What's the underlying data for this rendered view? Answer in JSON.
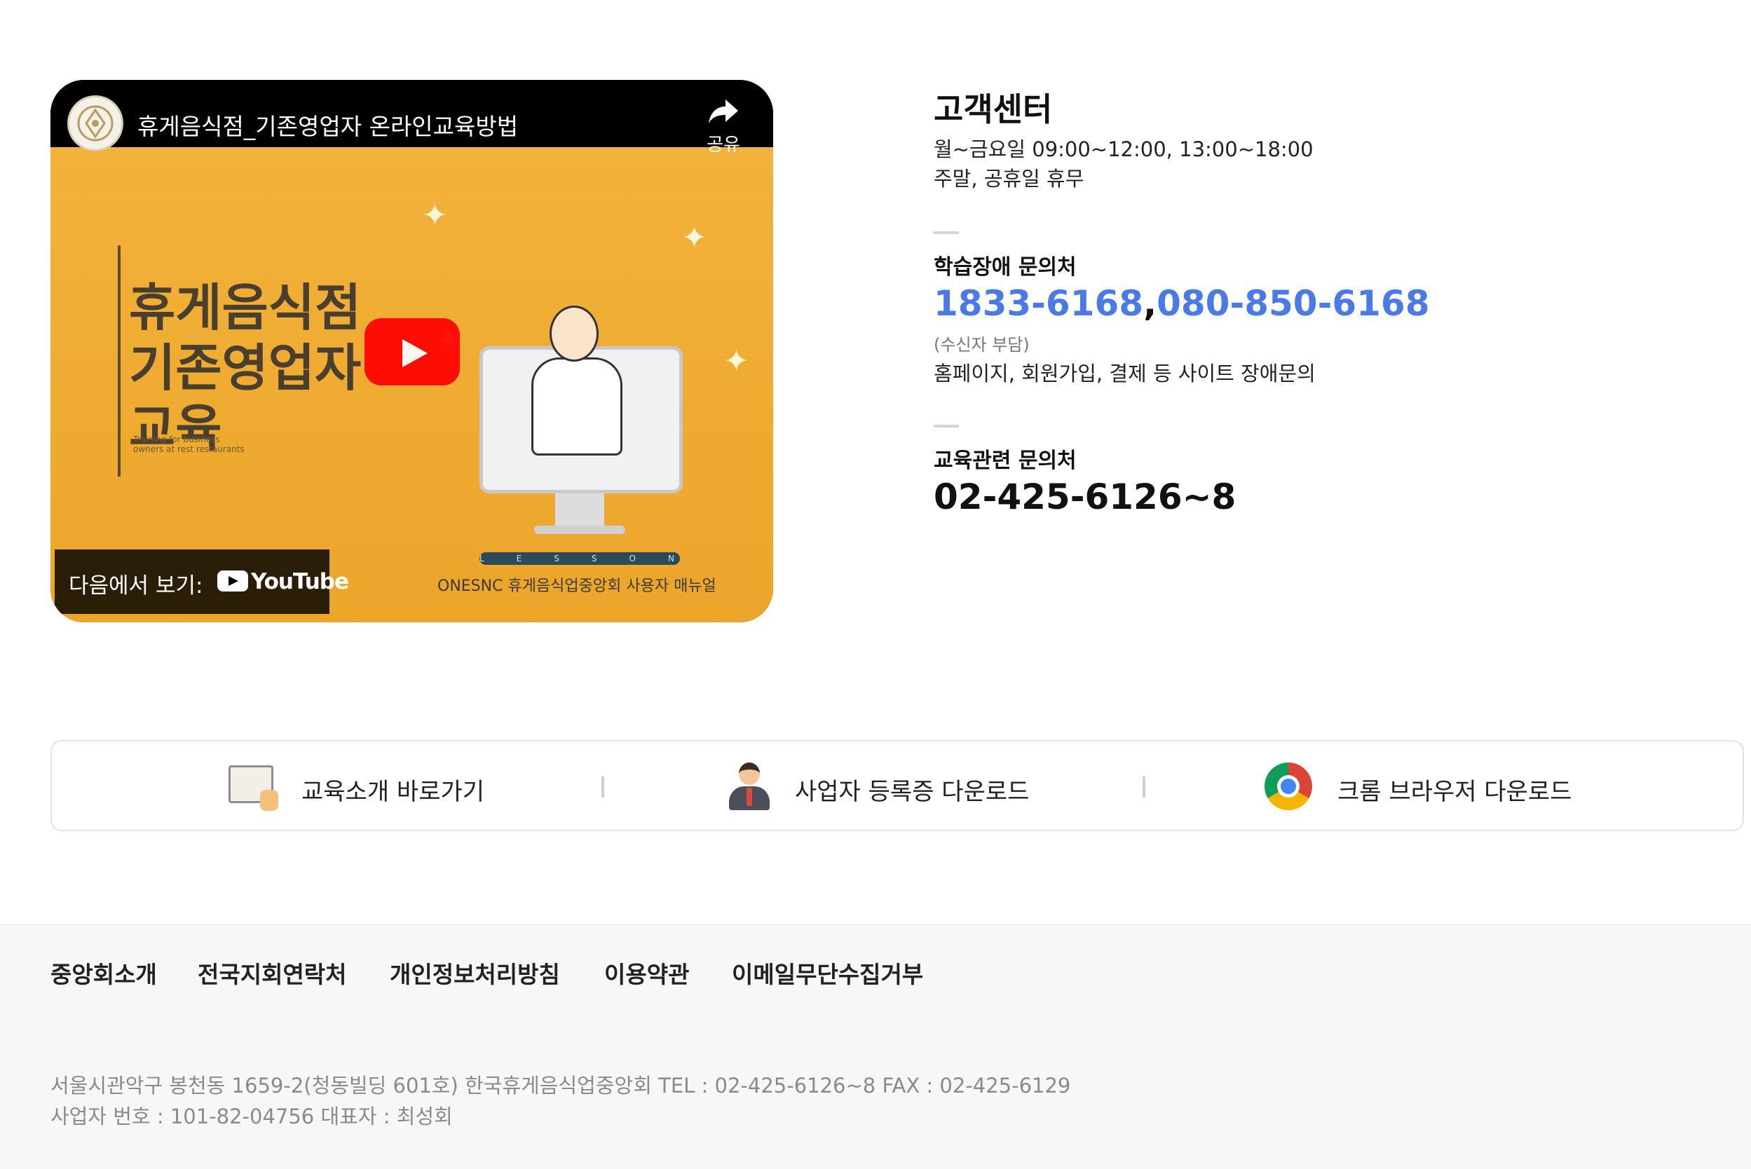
{
  "video": {
    "title": "휴게음식점_기존영업자 온라인교육방법",
    "share_label": "공유",
    "thumbnail_title_lines": [
      "휴게음식점",
      "기존영업자",
      "교육"
    ],
    "thumbnail_small_text": "Training for business owners at rest restaurants",
    "thumbnail_lesson": "LESSON",
    "thumbnail_footer": "ONESNC 휴게음식업중앙회 사용자 매뉴얼",
    "watch_on_label": "다음에서 보기:",
    "youtube_label": "YouTube",
    "play_icon": "play-icon"
  },
  "customer_center": {
    "title": "고객센터",
    "hours_weekday": "월~금요일 09:00~12:00, 13:00~18:00",
    "hours_weekend": "주말, 공휴일 휴무",
    "learning_issue": {
      "heading": "학습장애 문의처",
      "phone1": "1833-6168",
      "separator": ",",
      "phone2": "080-850-6168",
      "note": "(수신자 부담)",
      "description": "홈페이지, 회원가입, 결제 등 사이트 장애문의"
    },
    "education": {
      "heading": "교육관련 문의처",
      "phone": "02-425-6126~8"
    },
    "accent_color": "#4a7ae6"
  },
  "quick_links": [
    {
      "label": "교육소개 바로가기",
      "icon": "book-hand-icon"
    },
    {
      "label": "사업자 등록증 다운로드",
      "icon": "businessman-icon"
    },
    {
      "label": "크롬 브라우저 다운로드",
      "icon": "chrome-icon"
    }
  ],
  "footer": {
    "nav": [
      "중앙회소개",
      "전국지회연락처",
      "개인정보처리방침",
      "이용약관",
      "이메일무단수집거부"
    ],
    "address_line": "서울시관악구 봉천동 1659-2(청동빌딩 601호) 한국휴게음식업중앙회 TEL : 02-425-6126~8 FAX : 02-425-6129",
    "business_line": "사업자 번호 : 101-82-04756 대표자 : 최성회"
  }
}
